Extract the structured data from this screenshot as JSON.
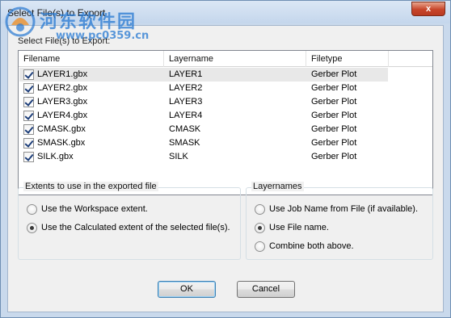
{
  "window": {
    "title": "Select File(s) to Export",
    "close_label": "x"
  },
  "watermark": {
    "site_name_cn": "河东软件园",
    "url": "www.pc0359.cn"
  },
  "file_section": {
    "label": "Select File(s) to Export:",
    "columns": [
      "Filename",
      "Layername",
      "Filetype"
    ],
    "rows": [
      {
        "checked": true,
        "filename": "LAYER1.gbx",
        "layername": "LAYER1",
        "filetype": "Gerber Plot"
      },
      {
        "checked": true,
        "filename": "LAYER2.gbx",
        "layername": "LAYER2",
        "filetype": "Gerber Plot"
      },
      {
        "checked": true,
        "filename": "LAYER3.gbx",
        "layername": "LAYER3",
        "filetype": "Gerber Plot"
      },
      {
        "checked": true,
        "filename": "LAYER4.gbx",
        "layername": "LAYER4",
        "filetype": "Gerber Plot"
      },
      {
        "checked": true,
        "filename": "CMASK.gbx",
        "layername": "CMASK",
        "filetype": "Gerber Plot"
      },
      {
        "checked": true,
        "filename": "SMASK.gbx",
        "layername": "SMASK",
        "filetype": "Gerber Plot"
      },
      {
        "checked": true,
        "filename": "SILK.gbx",
        "layername": "SILK",
        "filetype": "Gerber Plot"
      }
    ]
  },
  "extents_group": {
    "title": "Extents to use in the exported file",
    "options": [
      {
        "label": "Use the Workspace extent.",
        "selected": false
      },
      {
        "label": "Use the Calculated extent of the selected file(s).",
        "selected": true
      }
    ]
  },
  "layernames_group": {
    "title": "Layernames",
    "options": [
      {
        "label": "Use Job Name from File (if available).",
        "selected": false
      },
      {
        "label": "Use File name.",
        "selected": true
      },
      {
        "label": "Combine both above.",
        "selected": false
      }
    ]
  },
  "buttons": {
    "ok_label": "OK",
    "cancel_label": "Cancel"
  }
}
